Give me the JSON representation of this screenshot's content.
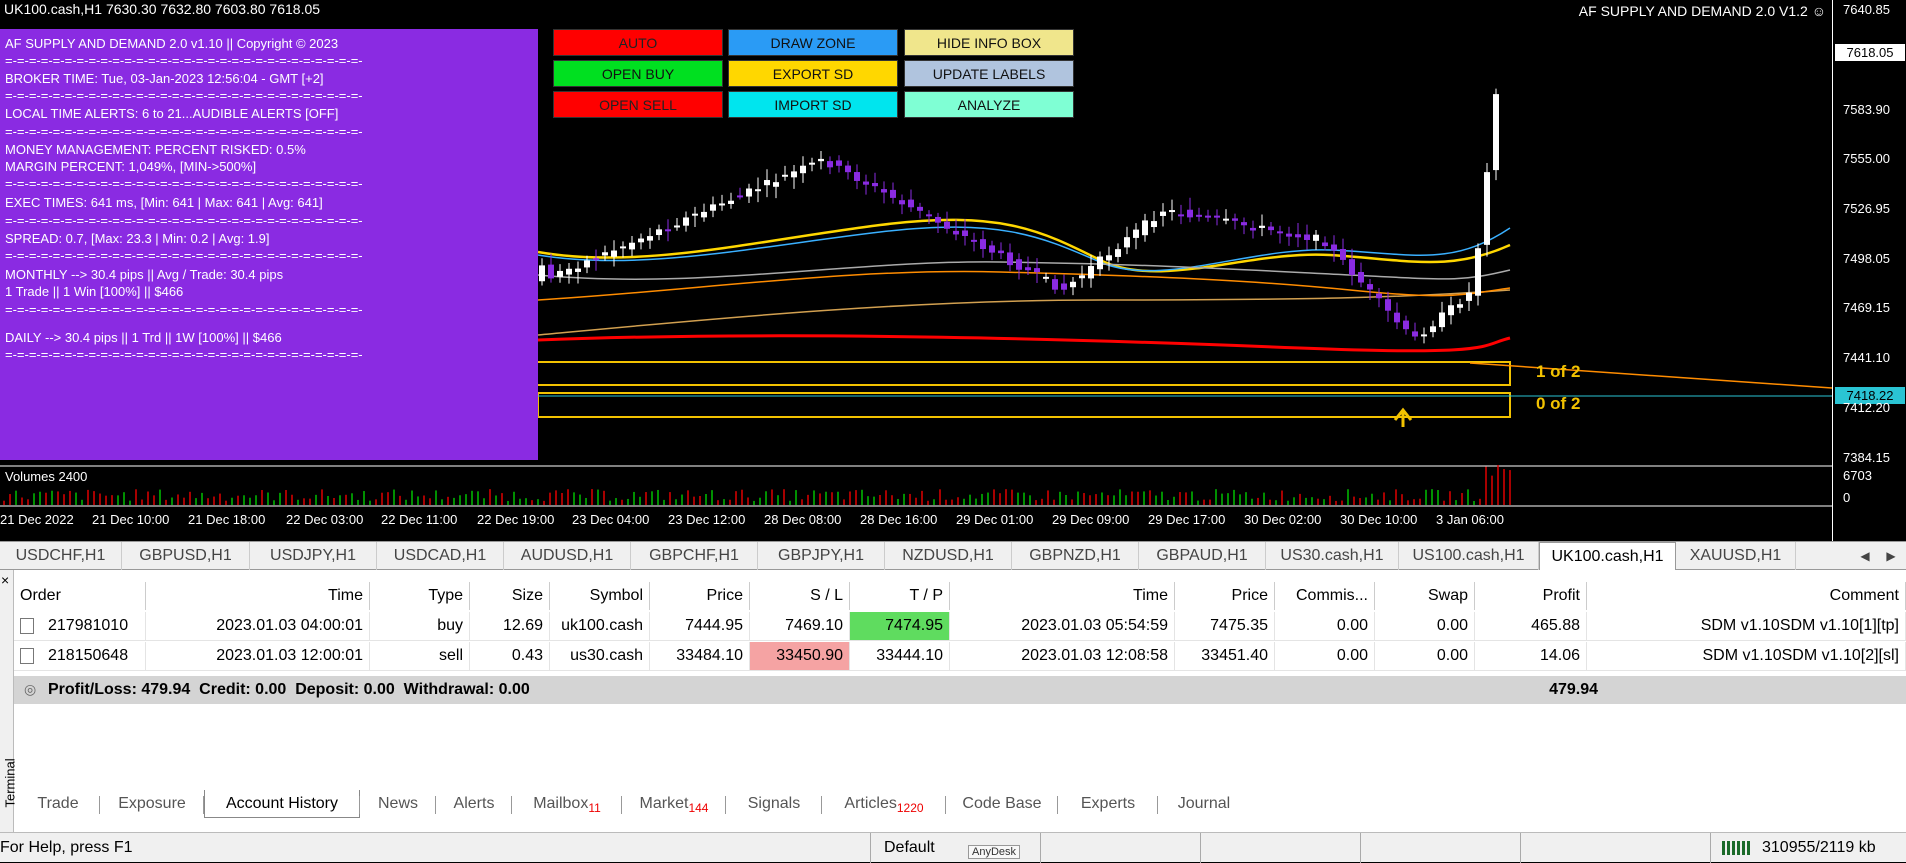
{
  "header": {
    "symbol_ohlc": "UK100.cash,H1  7630.30 7632.80 7603.80 7618.05",
    "ea_title": "AF SUPPLY AND DEMAND 2.0 V1.2"
  },
  "info_box": {
    "lines": [
      "AF SUPPLY AND DEMAND 2.0 v1.10 || Copyright © 2023",
      "=-=-=-=-=-=-=-=-=-=-=-=-=-=-=-=-=-=-=-=-=-=-=-=-=-=-=-=-=-=-",
      "BROKER TIME: Tue, 03-Jan-2023 12:56:04 - GMT [+2]",
      "=-=-=-=-=-=-=-=-=-=-=-=-=-=-=-=-=-=-=-=-=-=-=-=-=-=-=-=-=-=-",
      "LOCAL TIME ALERTS: 6 to 21...AUDIBLE ALERTS [OFF]",
      "=-=-=-=-=-=-=-=-=-=-=-=-=-=-=-=-=-=-=-=-=-=-=-=-=-=-=-=-=-=-",
      "MONEY MANAGEMENT: PERCENT RISKED: 0.5%",
      "MARGIN PERCENT: 1,049%, [MIN->500%]",
      "=-=-=-=-=-=-=-=-=-=-=-=-=-=-=-=-=-=-=-=-=-=-=-=-=-=-=-=-=-=-",
      "EXEC TIMES: 641 ms, [Min: 641 | Max: 641 | Avg: 641]",
      "=-=-=-=-=-=-=-=-=-=-=-=-=-=-=-=-=-=-=-=-=-=-=-=-=-=-=-=-=-=-",
      "SPREAD: 0.7, [Max: 23.3 | Min: 0.2 | Avg: 1.9]",
      "=-=-=-=-=-=-=-=-=-=-=-=-=-=-=-=-=-=-=-=-=-=-=-=-=-=-=-=-=-=-",
      "MONTHLY --> 30.4 pips || Avg / Trade: 30.4 pips",
      "1 Trade || 1 Win [100%] || $466",
      "=-=-=-=-=-=-=-=-=-=-=-=-=-=-=-=-=-=-=-=-=-=-=-=-=-=-=-=-=-=-",
      "DAILY --> 30.4 pips || 1 Trd || 1W [100%] || $466",
      "=-=-=-=-=-=-=-=-=-=-=-=-=-=-=-=-=-=-=-=-=-=-=-=-=-=-=-=-=-=-"
    ]
  },
  "buttons": {
    "auto": "AUTO",
    "draw_zone": "DRAW ZONE",
    "hide_info": "HIDE INFO BOX",
    "open_buy": "OPEN BUY",
    "export_sd": "EXPORT SD",
    "update_labels": "UPDATE LABELS",
    "open_sell": "OPEN SELL",
    "import_sd": "IMPORT SD",
    "analyze": "ANALYZE"
  },
  "price_axis": {
    "labels": [
      "7640.85",
      "7583.90",
      "7555.00",
      "7526.95",
      "7498.05",
      "7469.15",
      "7441.10",
      "7412.20",
      "7384.15"
    ],
    "current_price": "7618.05",
    "line_price": "7418.22",
    "volume_labels": [
      "6703",
      "0"
    ]
  },
  "zones": {
    "upper_label": "1 of 2",
    "lower_label": "0 of 2"
  },
  "volume_title": "Volumes 2400",
  "time_axis": [
    "21 Dec 2022",
    "21 Dec 10:00",
    "21 Dec 18:00",
    "22 Dec 03:00",
    "22 Dec 11:00",
    "22 Dec 19:00",
    "23 Dec 04:00",
    "23 Dec 12:00",
    "28 Dec 08:00",
    "28 Dec 16:00",
    "29 Dec 01:00",
    "29 Dec 09:00",
    "29 Dec 17:00",
    "30 Dec 02:00",
    "30 Dec 10:00",
    "3 Jan 06:00"
  ],
  "symbol_tabs": [
    "USDCHF,H1",
    "GBPUSD,H1",
    "USDJPY,H1",
    "USDCAD,H1",
    "AUDUSD,H1",
    "GBPCHF,H1",
    "GBPJPY,H1",
    "NZDUSD,H1",
    "GBPNZD,H1",
    "GBPAUD,H1",
    "US30.cash,H1",
    "US100.cash,H1",
    "UK100.cash,H1",
    "XAUUSD,H1"
  ],
  "active_symbol_tab": "UK100.cash,H1",
  "terminal": {
    "side_label": "Terminal",
    "columns": [
      "Order",
      "Time",
      "Type",
      "Size",
      "Symbol",
      "Price",
      "S / L",
      "T / P",
      "Time",
      "Price",
      "Commis...",
      "Swap",
      "Profit",
      "Comment"
    ],
    "rows": [
      [
        "217981010",
        "2023.01.03 04:00:01",
        "buy",
        "12.69",
        "uk100.cash",
        "7444.95",
        "7469.10",
        "7474.95",
        "2023.01.03 05:54:59",
        "7475.35",
        "0.00",
        "0.00",
        "465.88",
        "SDM v1.10SDM v1.10[1][tp]"
      ],
      [
        "218150648",
        "2023.01.03 12:00:01",
        "sell",
        "0.43",
        "us30.cash",
        "33484.10",
        "33450.90",
        "33444.10",
        "2023.01.03 12:08:58",
        "33451.40",
        "0.00",
        "0.00",
        "14.06",
        "SDM v1.10SDM v1.10[2][sl]"
      ]
    ],
    "summary": "Profit/Loss: 479.94  Credit: 0.00  Deposit: 0.00  Withdrawal: 0.00",
    "summary_profit": "479.94",
    "highlight_colors": {
      "tp": "#5fdc5f",
      "sl": "#f5a3a3"
    }
  },
  "bottom_tabs": [
    {
      "label": "Trade"
    },
    {
      "label": "Exposure"
    },
    {
      "label": "Account History",
      "active": true
    },
    {
      "label": "News"
    },
    {
      "label": "Alerts"
    },
    {
      "label": "Mailbox",
      "count": "11"
    },
    {
      "label": "Market",
      "count": "144"
    },
    {
      "label": "Signals"
    },
    {
      "label": "Articles",
      "count": "1220"
    },
    {
      "label": "Code Base"
    },
    {
      "label": "Experts"
    },
    {
      "label": "Journal"
    }
  ],
  "status_bar": {
    "help": "For Help, press F1",
    "profile": "Default",
    "anydesk": "AnyDesk",
    "traffic": "310955/2119 kb"
  },
  "colors": {
    "info_box": "#8A2BE2",
    "bull": "#ffffff",
    "bear": "#8A2BE2",
    "zone": "#f2c200",
    "sma_red": "#ff0000"
  }
}
